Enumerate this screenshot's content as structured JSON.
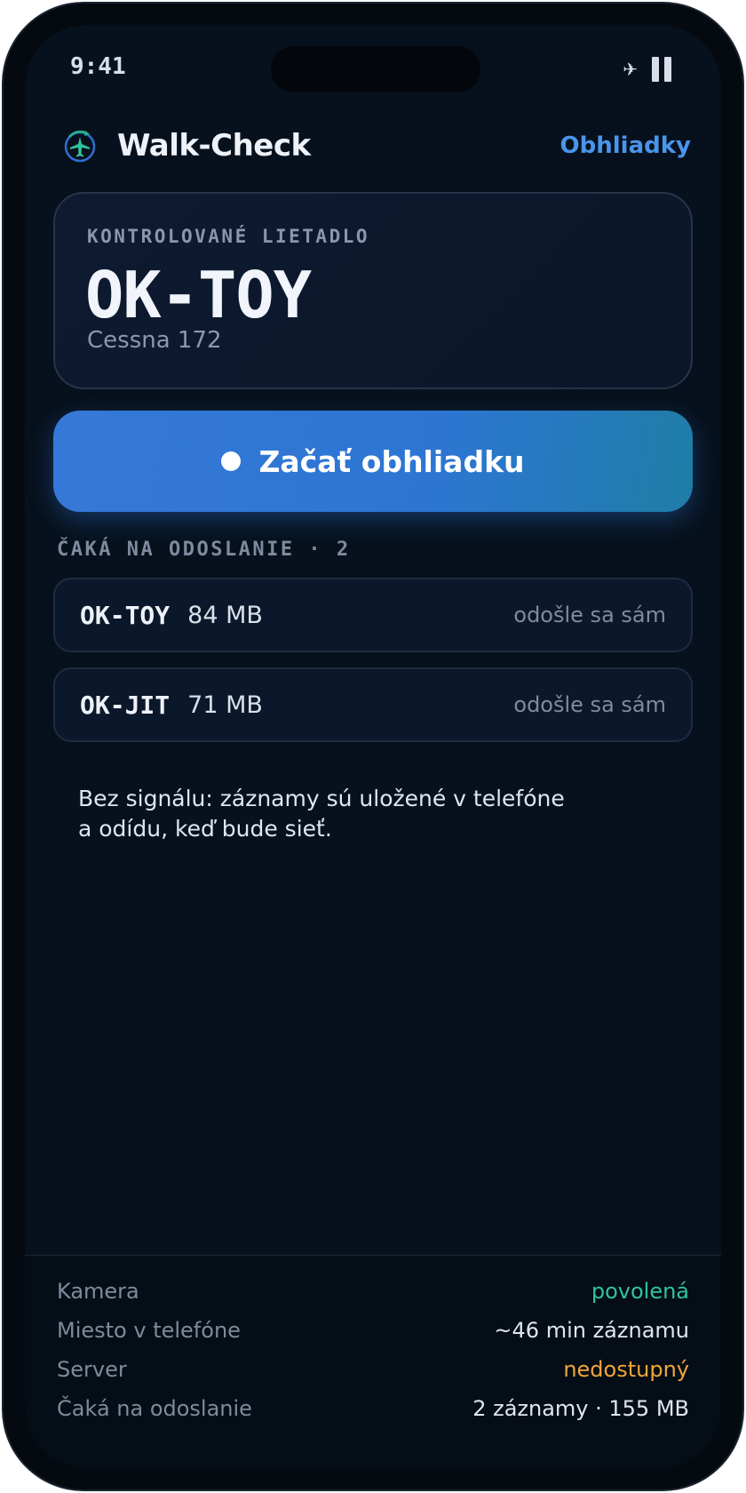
{
  "status_bar": {
    "time": "9:41",
    "icons": [
      "airplane-icon",
      "battery-icon"
    ]
  },
  "header": {
    "title": "Walk-Check",
    "link_label": "Obhliadky",
    "logo_icon": "plane-compass-icon"
  },
  "aircraft": {
    "label": "KONTROLOVANÉ LIETADLO",
    "registration": "OK-TOY",
    "type": "Cessna 172"
  },
  "start_button": {
    "label": "Začať obhliadku"
  },
  "pending": {
    "heading": "ČAKÁ NA ODOSLANIE · 2",
    "items": [
      {
        "registration": "OK-TOY",
        "size": "84 MB",
        "status": "odošle sa sám"
      },
      {
        "registration": "OK-JIT",
        "size": "71 MB",
        "status": "odošle sa sám"
      }
    ]
  },
  "offline_note": {
    "line1": "Bez signálu: záznamy sú uložené v telefóne",
    "line2": "a odídu, keď bude sieť."
  },
  "footer": {
    "rows": [
      {
        "label": "Kamera",
        "value": "povolená",
        "tone": "ok"
      },
      {
        "label": "Miesto v telefóne",
        "value": "~46 min záznamu",
        "tone": "neutral"
      },
      {
        "label": "Server",
        "value": "nedostupný",
        "tone": "warn"
      },
      {
        "label": "Čaká na odoslanie",
        "value": "2 záznamy · 155 MB",
        "tone": "neutral"
      }
    ]
  },
  "colors": {
    "background": "#07111d",
    "accent": "#4a95ec",
    "ok": "#2fc39a",
    "warn": "#f0a63a"
  }
}
